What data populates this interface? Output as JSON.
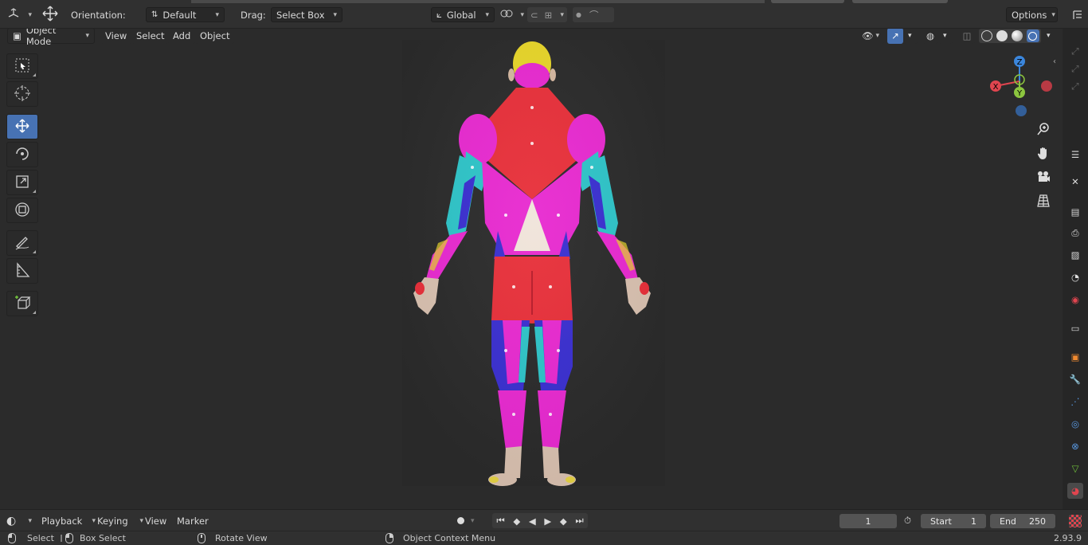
{
  "header": {
    "orientation_label": "Orientation:",
    "orientation_value": "Default",
    "drag_label": "Drag:",
    "drag_value": "Select Box",
    "transform_orientation": "Global",
    "options_label": "Options"
  },
  "viewport_header": {
    "mode": "Object Mode",
    "menus": [
      "View",
      "Select",
      "Add",
      "Object"
    ]
  },
  "gizmo": {
    "x": "X",
    "y": "Y",
    "z": "Z"
  },
  "timeline": {
    "menus": [
      "Playback",
      "Keying",
      "View",
      "Marker"
    ],
    "current_frame": "1",
    "start_label": "Start",
    "start_value": "1",
    "end_label": "End",
    "end_value": "250"
  },
  "statusbar": {
    "select": "Select",
    "box_select": "Box Select",
    "rotate_view": "Rotate View",
    "context_menu": "Object Context Menu",
    "version": "2.93.9"
  },
  "colors": {
    "accent": "#4772b3",
    "axis_x": "#e0454f",
    "axis_y": "#8cc63f",
    "axis_z": "#3b86dc",
    "muscle_red": "#e8303a",
    "muscle_magenta": "#e82ad0",
    "muscle_cyan": "#2ec4c8",
    "muscle_blue": "#3a2fd0",
    "head_yellow": "#e8d62a"
  },
  "icons": {
    "editor_type": "view3d-icon",
    "transform": "move-icon",
    "tools": [
      "select-box-icon",
      "cursor-icon",
      "move-icon",
      "rotate-icon",
      "scale-icon",
      "transform-icon",
      "annotate-icon",
      "measure-icon",
      "add-cube-icon"
    ],
    "nav": [
      "zoom-icon",
      "hand-icon",
      "camera-icon",
      "grid-icon"
    ],
    "properties": [
      "tool-icon",
      "render-icon",
      "output-icon",
      "view-layer-icon",
      "scene-icon",
      "world-icon",
      "collection-icon",
      "object-icon",
      "modifier-icon",
      "particles-icon",
      "physics-icon",
      "constraints-icon",
      "data-icon",
      "material-icon",
      "texture-icon"
    ]
  }
}
